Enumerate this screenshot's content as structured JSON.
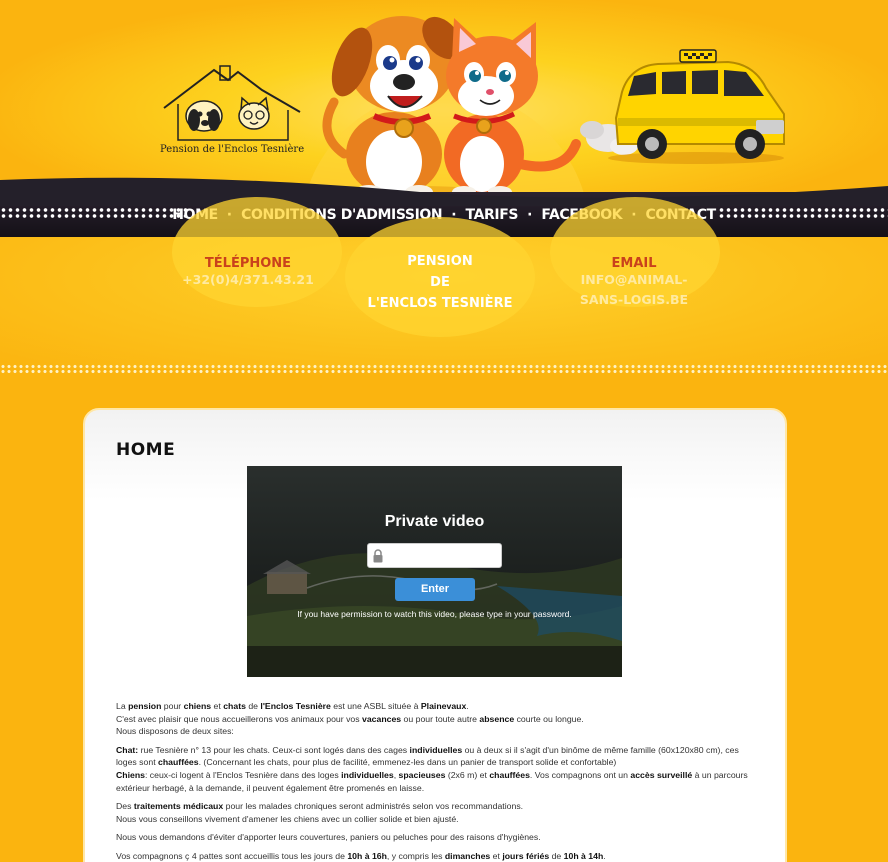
{
  "brand": {
    "logo_text": "Pension de l'Enclos Tesnière"
  },
  "nav": {
    "items": [
      {
        "label": "HOME"
      },
      {
        "label": "CONDITIONS D'ADMISSION"
      },
      {
        "label": "TARIFS"
      },
      {
        "label": "FACEBOOK"
      },
      {
        "label": "CONTACT"
      }
    ],
    "separator": "·"
  },
  "info": {
    "phone_title": "TÉLÉPHONE",
    "phone_value": "+32(0)4/371.43.21",
    "pension_lines": [
      "PENSION",
      "DE",
      "L'ENCLOS TESNIÈRE"
    ],
    "email_title": "EMAIL",
    "email_value_lines": [
      "INFO@ANIMAL-",
      "SANS-LOGIS.BE"
    ]
  },
  "page": {
    "title": "HOME"
  },
  "video": {
    "title": "Private video",
    "password_placeholder": "",
    "enter_label": "Enter",
    "help_text": "If you have permission to watch this video, please type in your password."
  },
  "content": {
    "p1": {
      "t1": "La ",
      "b1": "pension",
      "t2": " pour ",
      "b2": "chiens",
      "t3": " et ",
      "b3": "chats",
      "t4": " de ",
      "b4": "l'Enclos Tesnière",
      "t5": " est une ASBL située à ",
      "b5": "Plainevaux",
      "t6": ".",
      "l2a": "C'est avec plaisir que nous accueillerons vos animaux pour vos ",
      "l2b": "vacances",
      "l2c": " ou pour toute autre ",
      "l2d": "absence",
      "l2e": " courte ou longue.",
      "l3": "Nous disposons de deux sites:"
    },
    "p2": {
      "chat_label": "Chat:",
      "chat_a": "  rue Tesnière n° 13 pour les chats. Ceux-ci sont logés dans des cages ",
      "chat_b": "individuelles",
      "chat_c": " ou à deux si il s'agit d'un binôme de même famille (60x120x80 cm), ces loges sont ",
      "chat_d": "chauffées",
      "chat_e": ". (Concernant les chats, pour plus de facilité, emmenez-les dans un panier de transport solide et confortable)",
      "chien_label": "Chiens",
      "chien_a": ": ceux-ci logent à l'Enclos Tesnière dans des loges ",
      "chien_b": "individuelles",
      "chien_c": ", ",
      "chien_d": "spacieuses",
      "chien_e": " (2x6 m) et ",
      "chien_f": "chauffées",
      "chien_g": ". Vos compagnons ont un ",
      "chien_h": "accès surveillé",
      "chien_i": " à un parcours extérieur herbagé, à la demande, il peuvent également être promenés en laisse."
    },
    "p3": {
      "a": "Des ",
      "b": "traitements médicaux",
      "c": " pour les malades chroniques seront administrés selon vos recommandations.",
      "l2": "Nous vous conseillons vivement d'amener les chiens avec un collier solide et bien ajusté."
    },
    "p4": "Nous vous demandons d'éviter d'apporter leurs couvertures, paniers ou peluches pour des raisons d'hygiènes.",
    "p5": {
      "a": "Vos compagnons ç 4 pattes sont accueillis tous les jours de ",
      "b": "10h à 16h",
      "c": ", y compris les ",
      "d": "dimanches",
      "e": " et ",
      "f": "jours fériés",
      "g": " de ",
      "h": "10h à 14h",
      "i": "."
    }
  },
  "colors": {
    "background": "#fbb40f",
    "nav_bar": "#1c171f",
    "accent_red": "#c9411c",
    "enter_button": "#3b8fd8"
  }
}
